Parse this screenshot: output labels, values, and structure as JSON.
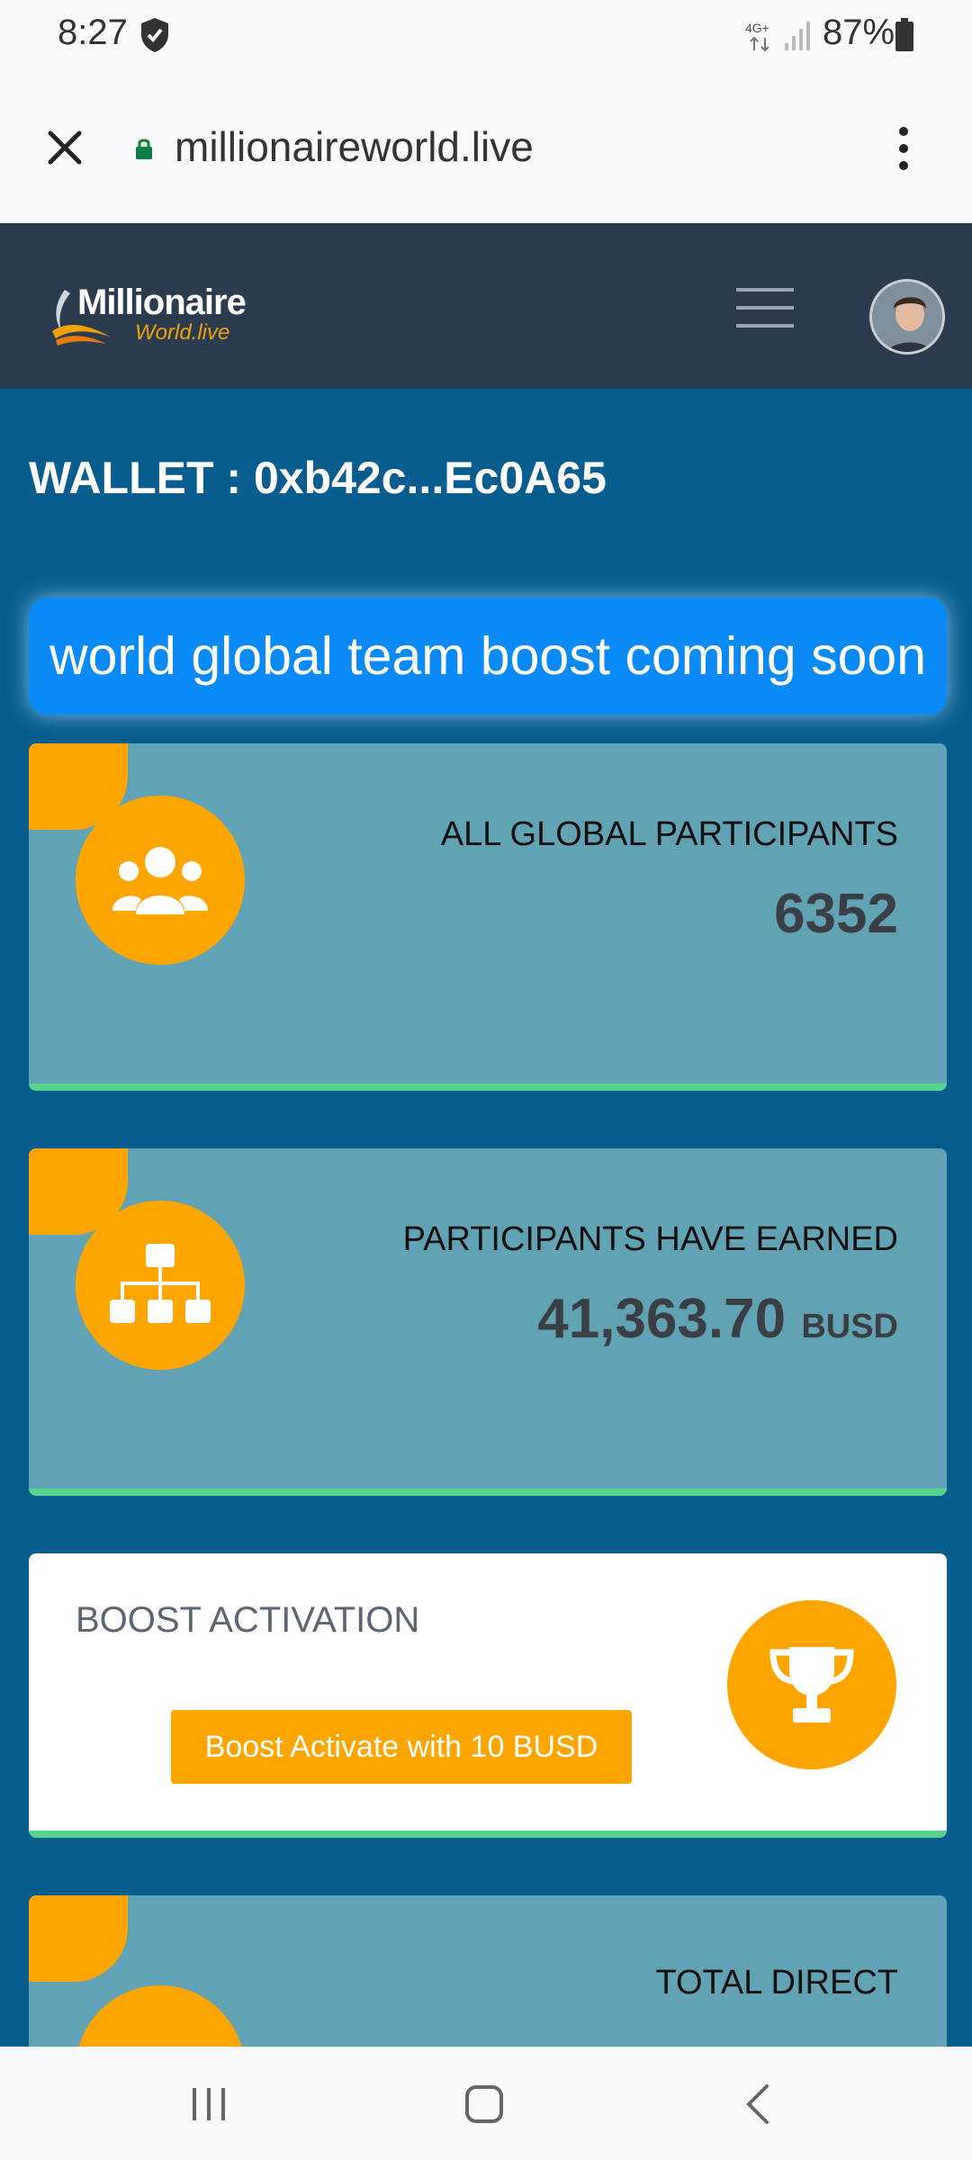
{
  "status": {
    "time": "8:27",
    "network": "4G+",
    "battery": "87%"
  },
  "browser": {
    "url": "millionaireworld.live"
  },
  "site": {
    "logo_line1": "Millionaire",
    "logo_line2": "World.live"
  },
  "wallet": {
    "text": "WALLET : 0xb42c...Ec0A65"
  },
  "banner": {
    "text": "world global team boost coming soon"
  },
  "cards": {
    "participants": {
      "title": "ALL GLOBAL PARTICIPANTS",
      "value": "6352",
      "icon": "users-icon"
    },
    "earned": {
      "title": "PARTICIPANTS HAVE EARNED",
      "value": "41,363.70",
      "unit": "BUSD",
      "icon": "network-icon"
    },
    "boost": {
      "title": "BOOST ACTIVATION",
      "button": "Boost Activate with 10 BUSD",
      "icon": "trophy-icon"
    },
    "direct": {
      "title": "TOTAL DIRECT"
    }
  },
  "colors": {
    "accent": "#ffa500",
    "header": "#2b3c50",
    "background": "#075d8d",
    "card": "#62a2b5",
    "banner": "#0a8af7",
    "card_border": "#54d48d"
  }
}
